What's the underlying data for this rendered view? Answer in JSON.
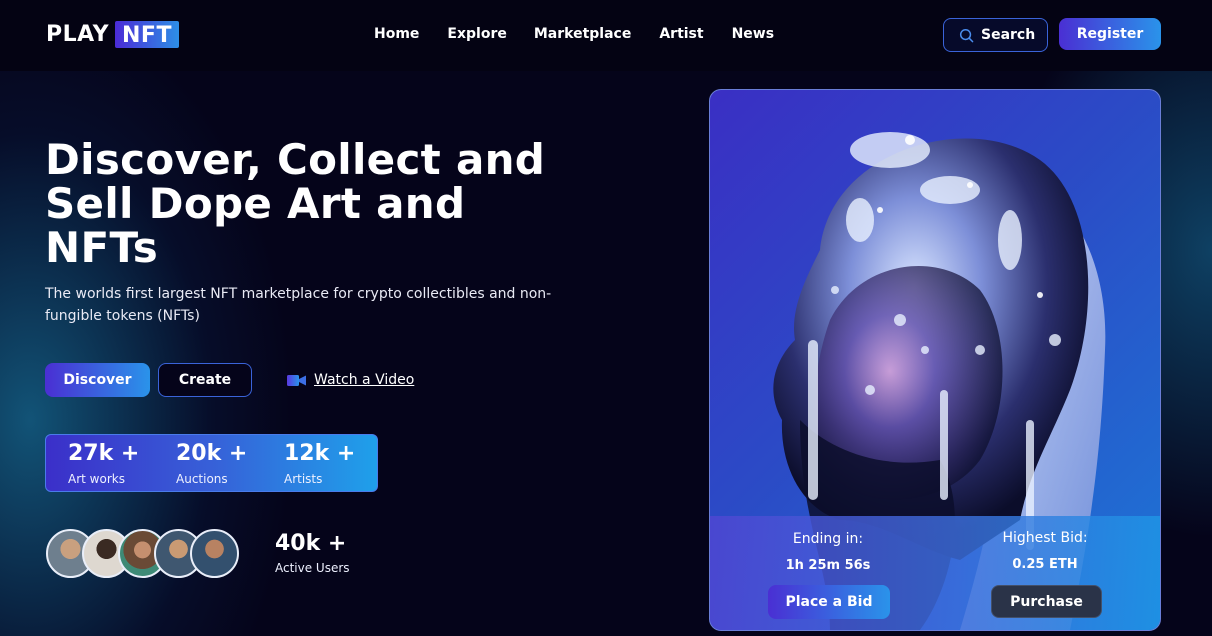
{
  "brand": {
    "play": "PLAY",
    "nft": "NFT"
  },
  "nav": {
    "items": [
      {
        "label": "Home"
      },
      {
        "label": "Explore"
      },
      {
        "label": "Marketplace"
      },
      {
        "label": "Artist"
      },
      {
        "label": "News"
      }
    ],
    "search_label": "Search",
    "register_label": "Register"
  },
  "hero": {
    "title_line1": "Discover, Collect and",
    "title_line2": "Sell Dope Art and",
    "title_line3": "NFTs",
    "subtitle": "The worlds first largest NFT marketplace for crypto collectibles and non-fungible tokens (NFTs)",
    "discover_label": "Discover",
    "create_label": "Create",
    "watch_label": "Watch a Video"
  },
  "stats": [
    {
      "value": "27k +",
      "label": "Art works"
    },
    {
      "value": "20k +",
      "label": "Auctions"
    },
    {
      "value": "12k +",
      "label": "Artists"
    }
  ],
  "users": {
    "value": "40k +",
    "label": "Active Users"
  },
  "card": {
    "ending_label": "Ending in:",
    "ending_value": "1h 25m 56s",
    "bid_label": "Highest Bid:",
    "bid_value": "0.25 ETH",
    "place_bid_label": "Place a Bid",
    "purchase_label": "Purchase"
  },
  "icons": {
    "search": "search-icon",
    "video": "video-camera-icon"
  },
  "colors": {
    "background": "#05041a",
    "accent_start": "#4a2fd3",
    "accent_end": "#2a93ea",
    "outline": "#3a63d9"
  }
}
